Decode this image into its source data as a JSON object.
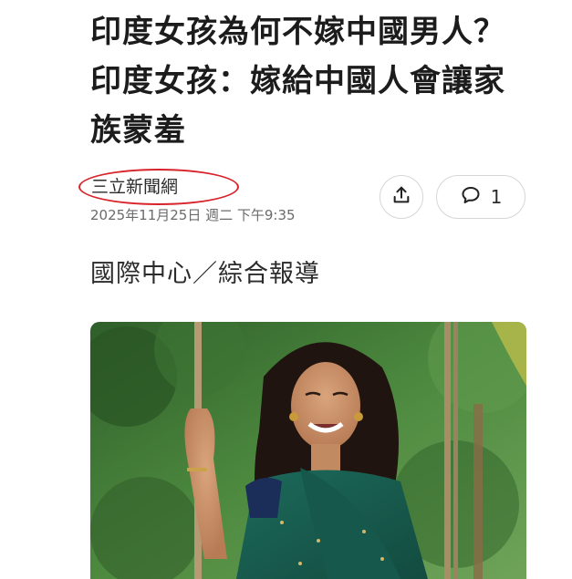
{
  "article": {
    "headline": "印度女孩為何不嫁中國男人？印度女孩：嫁給中國人會讓家族蒙羞",
    "source": "三立新聞網",
    "timestamp": "2025年11月25日 週二 下午9:35",
    "byline": "國際中心／綜合報導"
  },
  "actions": {
    "share_icon": "share-icon",
    "comment_icon": "comment-icon",
    "comment_count": "1"
  },
  "photo": {
    "subject": "woman-in-green-sari-on-swing"
  },
  "colors": {
    "highlight_circle": "#d8232a",
    "sari": "#1f6b5c",
    "background_foliage": "#3f7a3a"
  }
}
